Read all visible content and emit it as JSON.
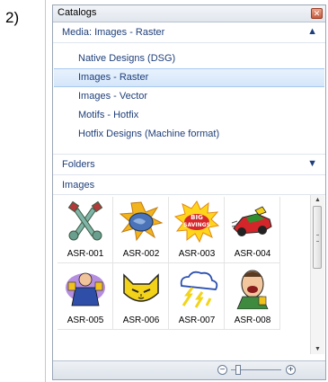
{
  "step_label": "2)",
  "window": {
    "title": "Catalogs"
  },
  "media_section": {
    "header": "Media: Images - Raster",
    "items": [
      {
        "label": "Native Designs (DSG)",
        "selected": false
      },
      {
        "label": "Images - Raster",
        "selected": true
      },
      {
        "label": "Images - Vector",
        "selected": false
      },
      {
        "label": "Motifs - Hotfix",
        "selected": false
      },
      {
        "label": "Hotfix Designs (Machine format)",
        "selected": false
      }
    ]
  },
  "folders_section": {
    "header": "Folders"
  },
  "images_section": {
    "header": "Images",
    "thumbnails": [
      {
        "caption": "ASR-001",
        "icon": "crossed-keys-icon"
      },
      {
        "caption": "ASR-002",
        "icon": "fist-burst-icon"
      },
      {
        "caption": "ASR-003",
        "icon": "big-savings-burst-icon",
        "art_text": [
          "BIG",
          "SAVINGS"
        ]
      },
      {
        "caption": "ASR-004",
        "icon": "race-car-icon"
      },
      {
        "caption": "ASR-005",
        "icon": "businessman-trophy-icon"
      },
      {
        "caption": "ASR-006",
        "icon": "cat-face-icon"
      },
      {
        "caption": "ASR-007",
        "icon": "storm-cloud-lightning-icon"
      },
      {
        "caption": "ASR-008",
        "icon": "laughing-man-icon"
      }
    ]
  },
  "colors": {
    "accent": "#1f3f7a",
    "selected_bg": "#d4e6fa",
    "close_button": "#c75a3c"
  }
}
